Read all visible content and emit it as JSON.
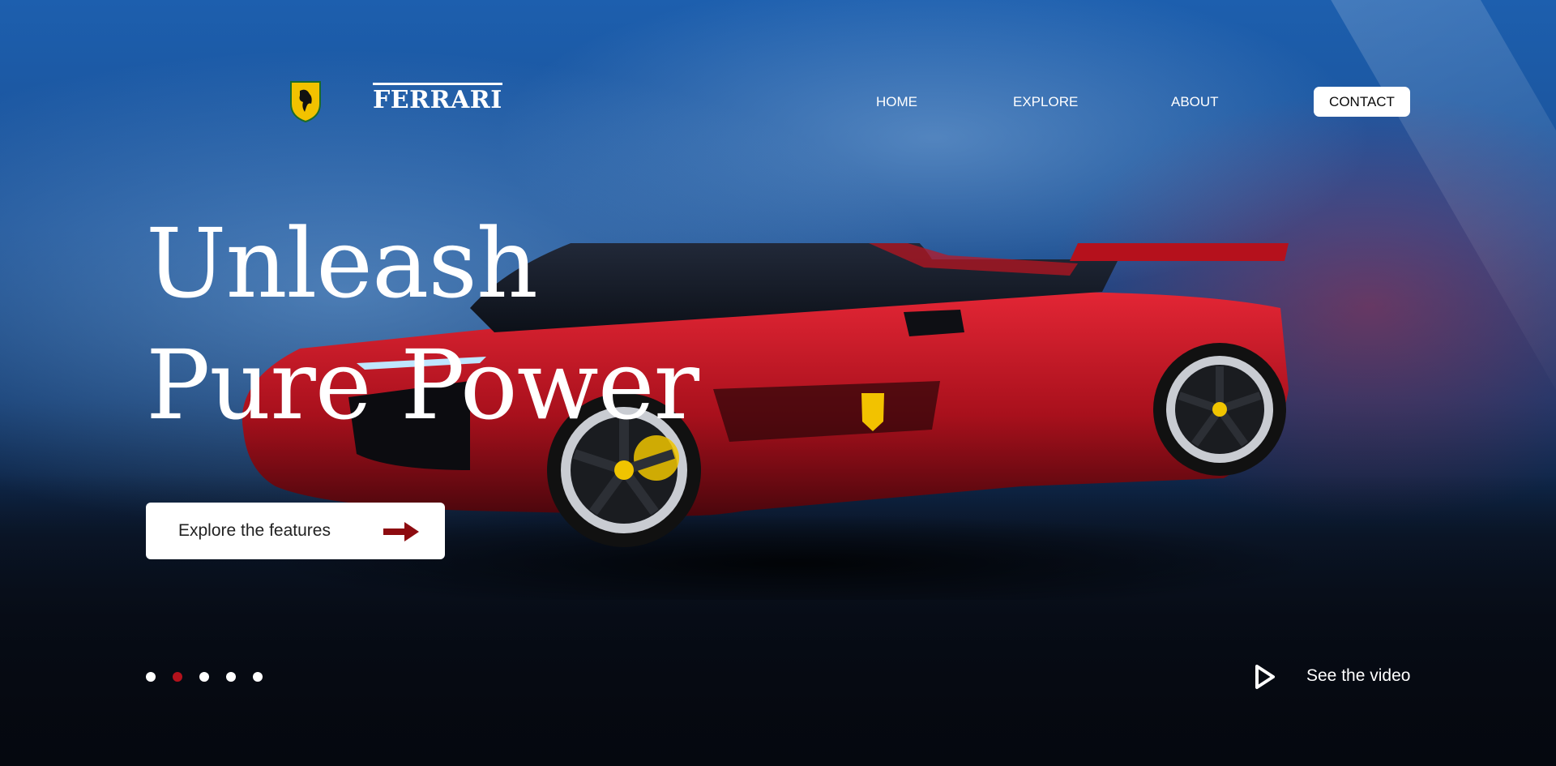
{
  "brand": {
    "name": "FERRARI",
    "logo_icon": "prancing-horse-shield-icon",
    "accent_color": "#b3121c",
    "shield_color": "#f2c200"
  },
  "nav": {
    "items": [
      {
        "label": "HOME"
      },
      {
        "label": "EXPLORE"
      },
      {
        "label": "ABOUT"
      }
    ],
    "contact_label": "CONTACT"
  },
  "hero": {
    "title_line1": "Unleash",
    "title_line2": "Pure Power",
    "cta_label": "Explore the features",
    "cta_icon": "arrow-right-icon"
  },
  "carousel": {
    "total_slides": 5,
    "active_index": 1
  },
  "video": {
    "label": "See the video",
    "icon": "play-icon"
  }
}
